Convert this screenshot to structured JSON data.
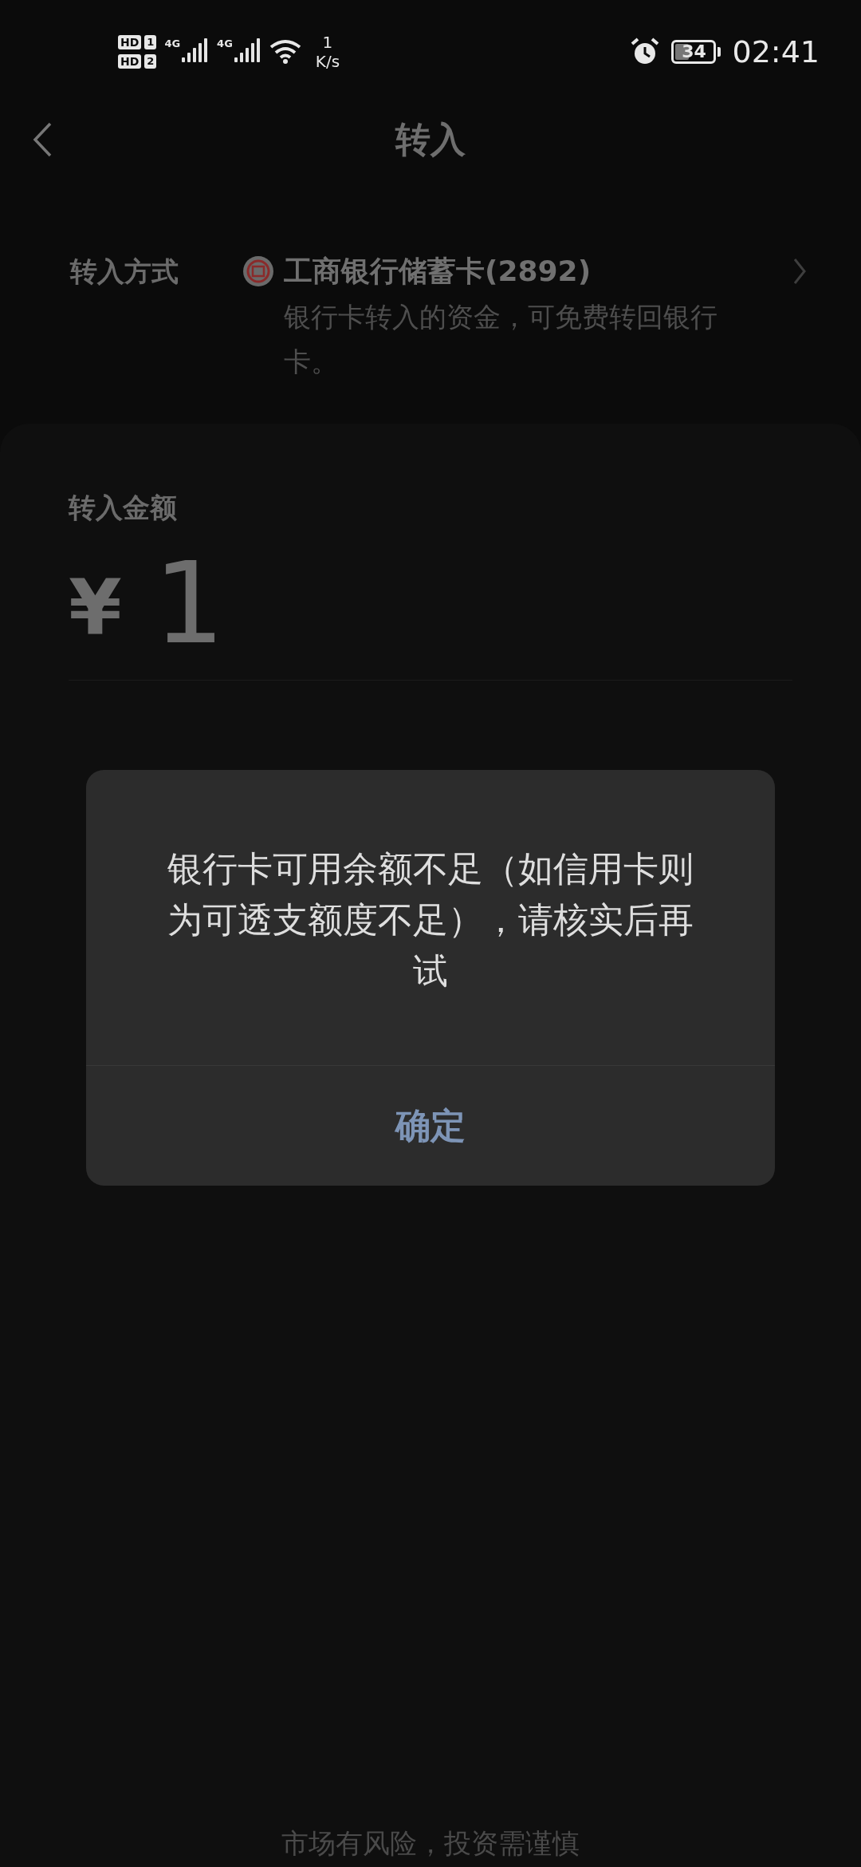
{
  "status_bar": {
    "sim_labels": [
      "HD",
      "HD"
    ],
    "sim_numbers": [
      "1",
      "2"
    ],
    "network": [
      "4G",
      "4G"
    ],
    "speed_value": "1",
    "speed_unit": "K/s",
    "battery": "34",
    "time": "02:41"
  },
  "header": {
    "title": "转入"
  },
  "transfer_method": {
    "label": "转入方式",
    "card": "工商银行储蓄卡(2892)",
    "note": "银行卡转入的资金，可免费转回银行卡。"
  },
  "amount": {
    "label": "转入金额",
    "currency": "¥",
    "value": "1"
  },
  "dialog": {
    "message": "银行卡可用余额不足（如信用卡则为可透支额度不足），请核实后再试",
    "buttons": [
      "确定"
    ]
  },
  "footer": {
    "text": "市场有风险，投资需谨慎"
  }
}
